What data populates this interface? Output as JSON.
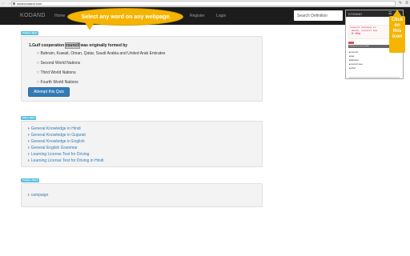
{
  "browser": {
    "url": "www.kodand.com"
  },
  "site": {
    "brand": "KODAND",
    "nav": [
      "Home",
      "Register",
      "Login"
    ],
    "search_placeholder": "Search Definition"
  },
  "callout": {
    "text": "Select any word on any webpage."
  },
  "arrow_callout": {
    "text": [
      "Click",
      "on",
      "this",
      "icon"
    ]
  },
  "popup": {
    "title": "KODAND",
    "code_lines": [
      "council meaning in",
      " Hindi, council mea",
      " नी परिषद"
    ],
    "subhead": "Definition of council in Hindi",
    "items": [
      "▸council",
      "▸sae",
      "▸Minister",
      "▸council sae",
      "▸other"
    ]
  },
  "quiz": {
    "tag": "Today's Quiz",
    "question_before": "1.Gulf cooperation ",
    "question_highlight": "council",
    "question_after": " was originally formed by",
    "options": [
      "Bahrain, Kuwait, Oman, Qatar, Saudi Arabia and United Arab Emirates",
      "Second World Nations",
      "Third World Nations",
      "Fourth World Nations"
    ],
    "button": "Attempt this Quiz"
  },
  "other_quiz": {
    "tag": "Other Quiz",
    "links": [
      "General Knowledge in Hindi",
      "General Knowledge in Gujarati",
      "General Knowledge in English",
      "General English Grammar",
      "Learning License Test for Driving",
      "Learning License Test for Driving in Hindi"
    ]
  },
  "todays_word": {
    "tag": "Today's Word",
    "word": "campaign"
  },
  "colors": {
    "accent": "#337ab7",
    "callout": "#f4b400",
    "tag": "#5bc0de",
    "navbar": "#1c1c1c"
  }
}
